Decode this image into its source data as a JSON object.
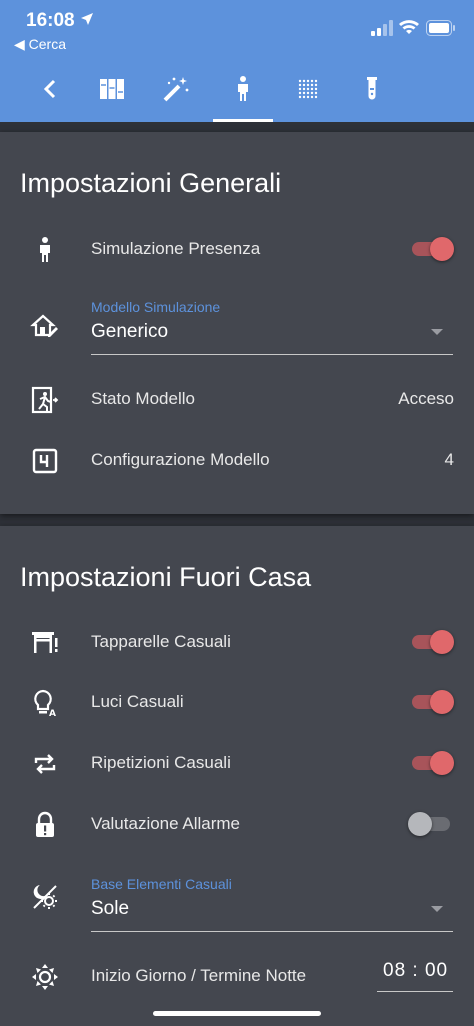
{
  "status_bar": {
    "time": "16:08",
    "back_app": "◀ Cerca"
  },
  "toolbar": {
    "items": [
      {
        "icon": "back-chevron-icon"
      },
      {
        "icon": "columns-icon"
      },
      {
        "icon": "magic-wand-icon"
      },
      {
        "icon": "person-icon",
        "active": true
      },
      {
        "icon": "dots-grid-icon"
      },
      {
        "icon": "test-tube-icon"
      }
    ]
  },
  "general": {
    "title": "Impostazioni Generali",
    "presence_label": "Simulazione Presenza",
    "presence_on": true,
    "model_field_label": "Modello Simulazione",
    "model_value": "Generico",
    "state_label": "Stato Modello",
    "state_value": "Acceso",
    "config_label": "Configurazione Modello",
    "config_value": "4"
  },
  "away": {
    "title": "Impostazioni Fuori Casa",
    "shutters_label": "Tapparelle Casuali",
    "shutters_on": true,
    "lights_label": "Luci Casuali",
    "lights_on": true,
    "repeat_label": "Ripetizioni Casuali",
    "repeat_on": true,
    "alarm_label": "Valutazione Allarme",
    "alarm_on": false,
    "base_field_label": "Base Elementi Casuali",
    "base_value": "Sole",
    "day_label": "Inizio Giorno / Termine Notte",
    "day_time": "08 : 00"
  },
  "colors": {
    "accent": "#5d92dc",
    "toggle_on": "#e0686b",
    "card": "#44474f",
    "background": "#2e3138"
  }
}
